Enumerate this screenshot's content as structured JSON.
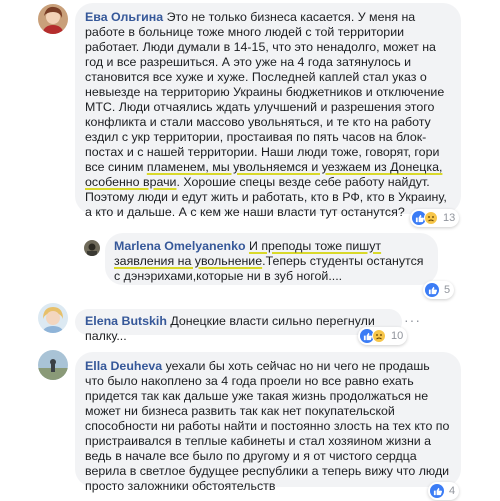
{
  "comments": [
    {
      "author": "Ева Ольгина",
      "text_1": "Это не только бизнеса касается. У меня на работе в больнице тоже много людей с той территории работает. Люди думали в 14-15, что это ненадолго, может на год и все разрешиться. А это уже на 4 года затянулось и становится все хуже и хуже. Последней каплей стал указ о невыезде на территорию Украины бюджетников и отключение МТС. Люди отчаялись ждать улучшений и разрешения этого конфликта и стали массово увольняться, и те кто на работу ездил с укр территории, простаивая по пять часов на блок-постах и с нашей территории. Наши люди тоже, говорят, гори все синим ",
      "text_hl": "пламенем, мы увольняемся и уезжаем из Донецка, особенно врачи",
      "text_2": ". Хорошие спецы везде себе работу найдут. Поэтому люди и едут жить и работать, кто в РФ, кто в Украину, а кто и дальше. А с кем же наши власти тут останутся?",
      "reaction_count": "13"
    },
    {
      "author": "Marlena Omelyanenko",
      "text_hl": "И преподы тоже пишут заявления на увольнение",
      "text_2": ".Теперь студенты останутся с дэнэрихами,которые ни в зуб ногой....",
      "reaction_count": "5"
    },
    {
      "author": "Elena Butskih",
      "text": "Донецкие власти сильно перегнули палку...",
      "reaction_count": "10"
    },
    {
      "author": "Ella Deuheva",
      "text": "уехали бы хоть сейчас но ни чего не продашь что было накоплено за 4 года проели но все равно ехать придется так как дальше уже такая жизнь продолжаться не может ни бизнеса развить так как нет покупательской способности ни работы найти и постоянно злость на тех кто по пристраивался в теплые кабинеты и стал хозяином жизни а ведь в начале все было по другому и я от чистого сердца верила в светлое будущее республики а теперь вижу что люди просто заложники обстоятельств",
      "reaction_count": "4"
    }
  ],
  "colors": {
    "author": "#365899",
    "bubble": "#f2f3f5",
    "highlight_underline": "#d9d92a",
    "like": "#3b7cf5"
  },
  "icons": [
    "like-icon",
    "sad-icon",
    "more-options-icon"
  ]
}
